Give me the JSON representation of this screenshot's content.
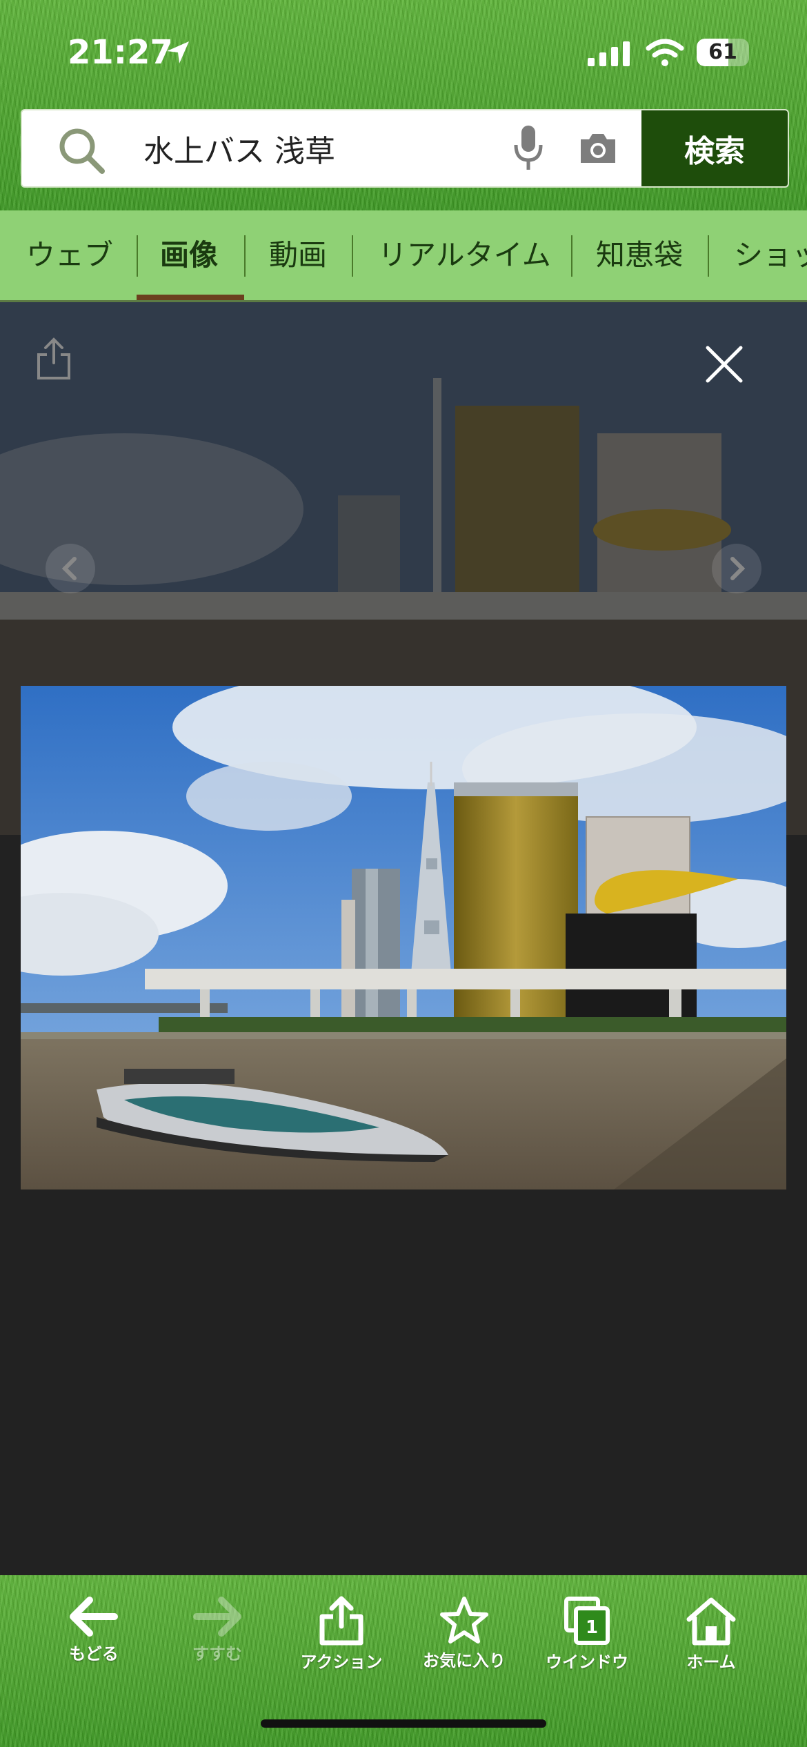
{
  "status_bar": {
    "time": "21:27",
    "battery_level": "61",
    "battery_fraction": 0.61
  },
  "search": {
    "query": "水上バス 浅草",
    "button_label": "検索"
  },
  "tabs": [
    {
      "label": "ウェブ",
      "active": false
    },
    {
      "label": "画像",
      "active": true
    },
    {
      "label": "動画",
      "active": false
    },
    {
      "label": "リアルタイム",
      "active": false
    },
    {
      "label": "知恵袋",
      "active": false
    },
    {
      "label": "ショッ",
      "active": false
    }
  ],
  "toolbar": {
    "back_label": "もどる",
    "forward_label": "すすむ",
    "action_label": "アクション",
    "favorites_label": "お気に入り",
    "window_label": "ウインドウ",
    "window_count": "1",
    "home_label": "ホーム"
  },
  "colors": {
    "search_button": "#1e4d0b",
    "tab_bar": "#8fd175",
    "active_tab_underline": "#6b3f1e",
    "viewer_background": "#222222"
  },
  "icons": [
    "location-arrow-icon",
    "signal-icon",
    "wifi-icon",
    "search-icon",
    "microphone-icon",
    "camera-icon",
    "share-icon",
    "close-icon",
    "chevron-left-icon",
    "chevron-right-icon",
    "arrow-left-icon",
    "arrow-right-icon",
    "star-icon",
    "windows-icon",
    "home-icon"
  ]
}
